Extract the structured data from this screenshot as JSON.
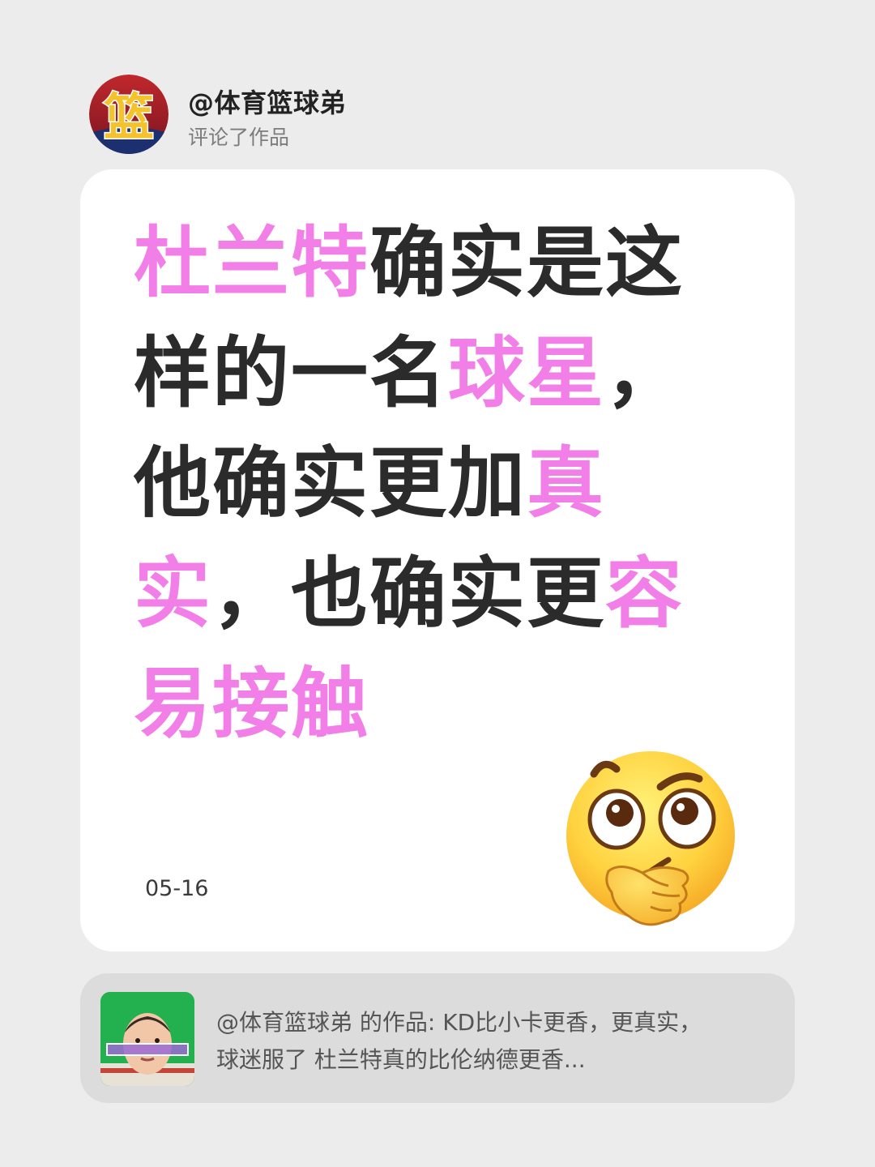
{
  "user": {
    "avatar_glyph": "篮",
    "name": "@体育篮球弟",
    "action": "评论了作品"
  },
  "comment": {
    "lines": [
      [
        {
          "text": "杜兰特",
          "hl": true
        },
        {
          "text": "确实是这",
          "hl": false
        }
      ],
      [
        {
          "text": "样的一名",
          "hl": false
        },
        {
          "text": "球星",
          "hl": true
        },
        {
          "text": "，",
          "hl": false
        }
      ],
      [
        {
          "text": "他确实更加",
          "hl": false
        },
        {
          "text": "真",
          "hl": true
        }
      ],
      [
        {
          "text": "实",
          "hl": true
        },
        {
          "text": "，也确实更",
          "hl": false
        },
        {
          "text": "容",
          "hl": true
        }
      ],
      [
        {
          "text": "易接触",
          "hl": true
        }
      ]
    ],
    "date": "05-16",
    "emoji_icon": "thinking-face-icon"
  },
  "work": {
    "line1": "@体育篮球弟 的作品: KD比小卡更香，更真实，",
    "line2": "球迷服了 杜兰特真的比伦纳德更香..."
  },
  "colors": {
    "highlight": "#f27ee8",
    "text": "#2b2b2b",
    "background": "#ececec",
    "card": "#ffffff",
    "work_card": "#dcdcdc"
  }
}
